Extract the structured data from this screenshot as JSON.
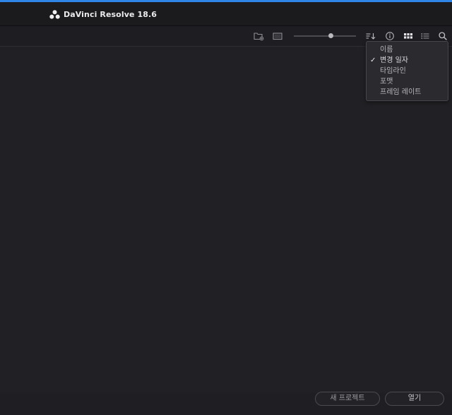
{
  "window": {
    "title": "DaVinci Resolve 18.6"
  },
  "toolbar": {
    "icons": [
      "new-folder-icon",
      "project-thumbnail-icon",
      "zoom-slider",
      "sort-icon",
      "info-icon",
      "grid-view-icon",
      "list-view-icon",
      "search-icon"
    ],
    "zoom_level": 0.62
  },
  "sort_menu": {
    "items": [
      {
        "label": "이름",
        "selected": false
      },
      {
        "label": "변경 일자",
        "selected": true
      },
      {
        "label": "타임라인",
        "selected": false
      },
      {
        "label": "포맷",
        "selected": false
      },
      {
        "label": "프레임 레이트",
        "selected": false
      }
    ],
    "check_mark": "✓"
  },
  "footer": {
    "new_project_label": "새 프로젝트",
    "open_label": "열기"
  },
  "colors": {
    "accent": "#2f86e6",
    "background": "#1f1f23",
    "menu_background": "#2a2a2f"
  }
}
